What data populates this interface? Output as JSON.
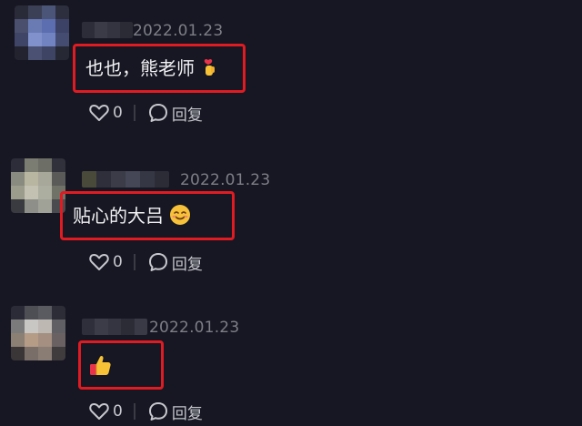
{
  "colors": {
    "background": "#161722",
    "highlight_border": "#e01b22",
    "timestamp": "#7d7e86",
    "text": "#f2f2f4"
  },
  "comments": [
    {
      "timestamp": "2022.01.23",
      "text": "也也，熊老师",
      "emoji": "finger-heart-icon",
      "likes": "0",
      "reply_label": "回复"
    },
    {
      "timestamp": "2022.01.23",
      "text": "贴心的大吕",
      "emoji": "smiling-face-icon",
      "likes": "0",
      "reply_label": "回复"
    },
    {
      "timestamp": "2022.01.23",
      "text": "",
      "emoji": "thumbs-up-icon",
      "likes": "0",
      "reply_label": "回复"
    }
  ]
}
